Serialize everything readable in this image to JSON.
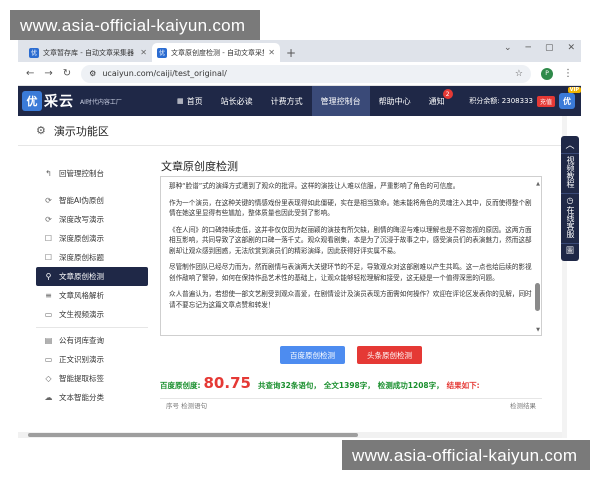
{
  "watermark": {
    "top": "www.asia-official-kaiyun.com",
    "bottom": "www.asia-official-kaiyun.com"
  },
  "browser": {
    "tabs": [
      {
        "label": "文章暂存库 - 自动文章采集器 -",
        "active": false
      },
      {
        "label": "文章原创度检测 - 自动文章采集",
        "active": true
      }
    ],
    "new_tab": "+",
    "url": "ucaiyun.com/caiji/test_original/",
    "profile": "P"
  },
  "site": {
    "logo_mark": "优",
    "logo_name": "采云",
    "slogan": "AI时代内容工厂",
    "nav": [
      {
        "label": "首页",
        "icon": "grid-icon"
      },
      {
        "label": "站长必读"
      },
      {
        "label": "计费方式"
      },
      {
        "label": "管理控制台",
        "active": true
      },
      {
        "label": "帮助中心"
      },
      {
        "label": "通知",
        "badge": "2"
      }
    ],
    "points_label": "积分余额: 2308333",
    "points_tag": "充值",
    "avatar_mark": "优",
    "vip_tag": "VIP"
  },
  "page": {
    "header": "演示功能区",
    "sidebar": [
      {
        "label": "回管理控制台",
        "icon": "back-icon"
      },
      {
        "label": "智能AI伪原创",
        "icon": "refresh-icon",
        "gap_before": true
      },
      {
        "label": "深度改写演示",
        "icon": "refresh-icon"
      },
      {
        "label": "深度原创演示",
        "icon": "doc-icon"
      },
      {
        "label": "深度原创标题",
        "icon": "doc-icon"
      },
      {
        "label": "文章原创检测",
        "icon": "search-icon",
        "active": true
      },
      {
        "label": "文章风格解析",
        "icon": "style-icon"
      },
      {
        "label": "文生视频演示",
        "icon": "video-icon"
      },
      {
        "label": "公有词库查询",
        "icon": "book-icon",
        "sep_before": true
      },
      {
        "label": "正文识别演示",
        "icon": "monitor-icon"
      },
      {
        "label": "智能提取标签",
        "icon": "tag-icon"
      },
      {
        "label": "文本智能分类",
        "icon": "cloud-icon"
      }
    ],
    "title": "文章原创度检测",
    "paragraphs": [
      "那种“脸谱”式的演绎方式遭到了观众的批评。这样的演技让人难以信服，严重影响了角色的可信度。",
      "作为一个演员，在这种关键的情感戏份里表现得如此僵硬，实在是相当致命。她未能将角色的灵魂注入其中，反而使得整个剧情在她这里显得有些尴尬，整体质量也因此受到了影响。",
      "《在人间》的口碑持续走低，这并非仅仅因为赵丽颖的演技有所欠缺，剧情的晦涩与难以理解也是不容忽视的原因。这两方面相互影响，共同导致了这部剧的口碑一落千丈。观众观看剧集，本是为了沉浸于故事之中，感受演员们的表演魅力，然而这部剧却让观众感到困惑，无法欣赏到演员们的精彩演绎，因此获得好评实属不易。",
      "尽管制作团队已经尽力而为，然而剧情与表演两大关键环节的不足，导致观众对这部剧难以产生共鸣。这一点也给后续的影视创作敲响了警钟，如何在保持作品艺术性的基础上，让观众能够轻松理解和接受，这无疑是一个值得深思的问题。",
      "众人普遍认为，若想使一部文艺剧受到观众喜爱，在剧情设计及演员表现方面需如何操作？欢迎在评论区发表你的见解，同时请不要忘记为这篇文章点赞和转发！"
    ],
    "buttons": {
      "baidu": "百度原创检测",
      "toutiao": "头条原创检测"
    },
    "result": {
      "label": "百度原创度:",
      "score": "80.75",
      "sentences": "共查询32条语句，",
      "chars": "全文1398字，",
      "success": "检测成功1208字，",
      "result_label": "结果如下:"
    },
    "table": {
      "left": "序号   检测语句",
      "right": "检测结果"
    }
  },
  "float_nav": {
    "chevron": "︿",
    "items": [
      "视频教程",
      "在线客服"
    ],
    "extra": "圖"
  }
}
